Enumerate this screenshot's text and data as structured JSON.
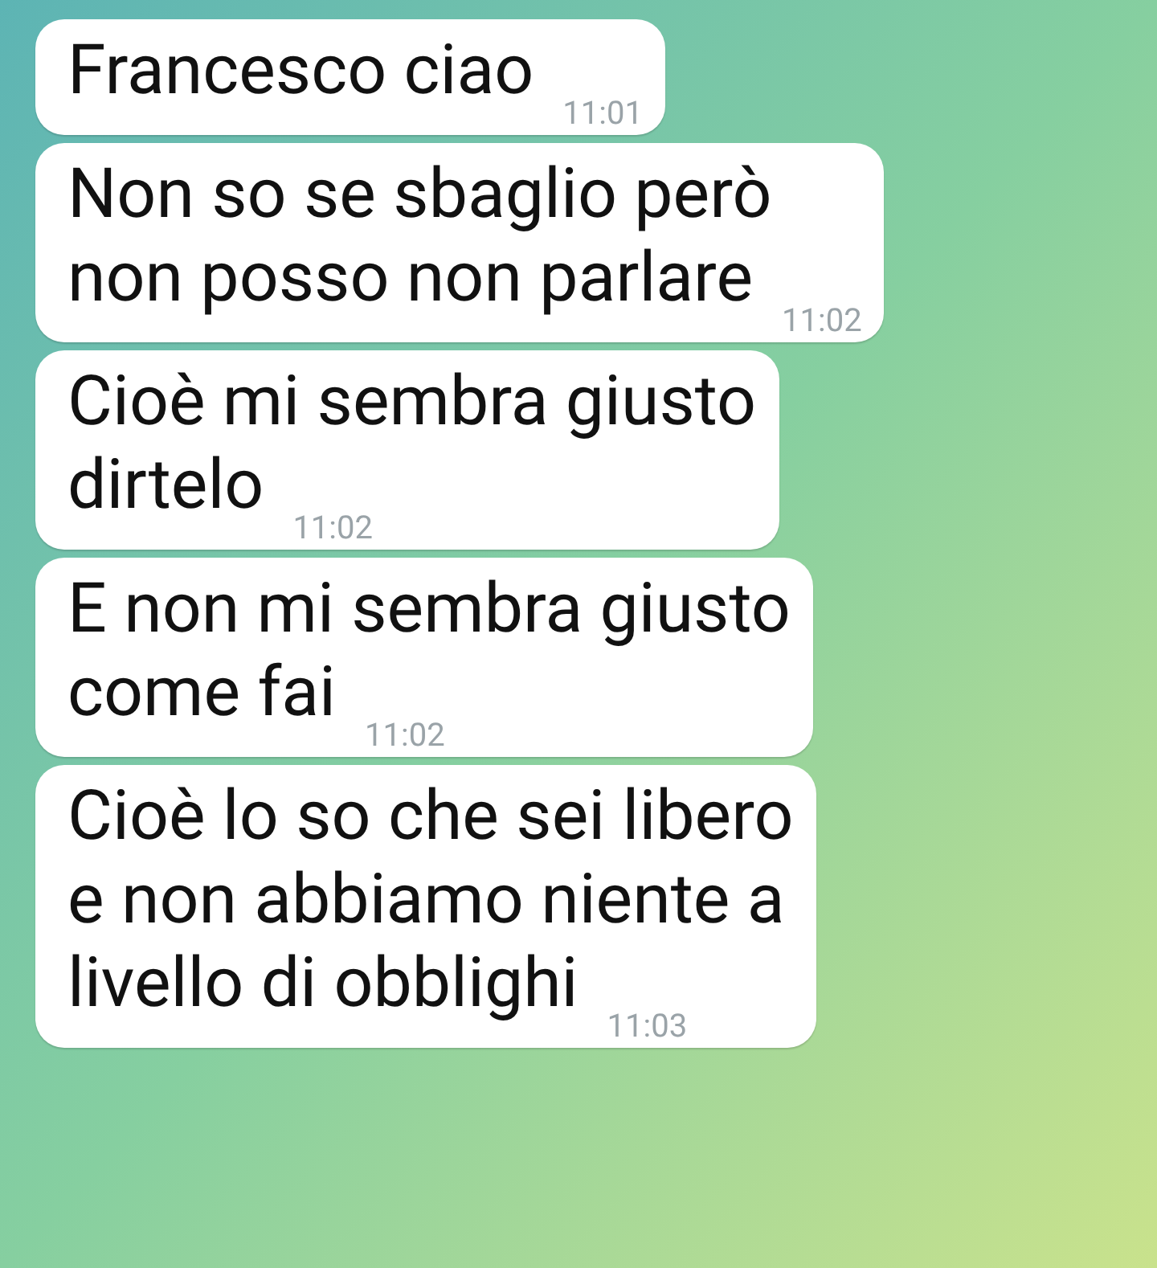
{
  "messages": [
    {
      "lines": [
        "Francesco ciao"
      ],
      "time": "11:01"
    },
    {
      "lines": [
        "Non so se sbaglio però",
        "non posso non parlare"
      ],
      "time": "11:02"
    },
    {
      "lines": [
        "Cioè mi sembra giusto",
        "dirtelo"
      ],
      "time": "11:02"
    },
    {
      "lines": [
        "E non mi sembra giusto",
        "come fai"
      ],
      "time": "11:02"
    },
    {
      "lines": [
        "Cioè lo so che sei libero",
        "e non abbiamo niente a",
        "livello di obblighi"
      ],
      "time": "11:03"
    }
  ]
}
